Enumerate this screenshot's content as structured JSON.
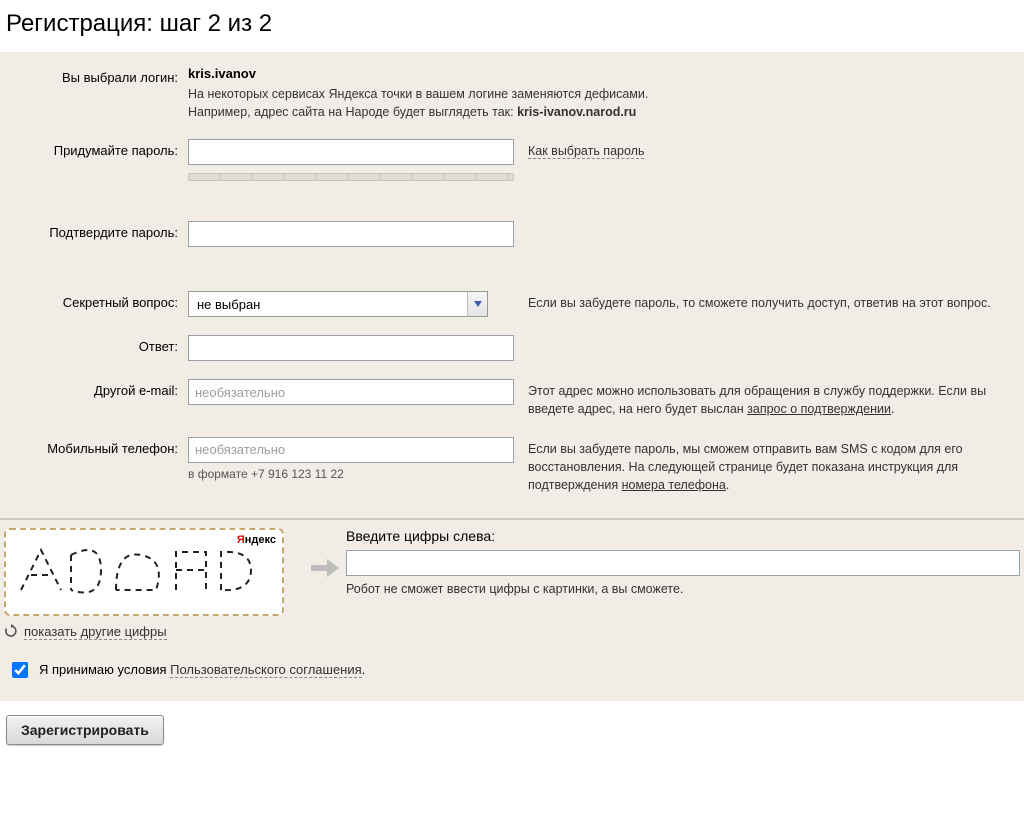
{
  "page_title": "Регистрация: шаг 2 из 2",
  "login": {
    "label": "Вы выбрали логин:",
    "value": "kris.ivanov",
    "note_line1": "На некоторых сервисах Яндекса точки в вашем логине заменяются дефисами.",
    "note_line2_prefix": "Например, адрес сайта на Народе будет выглядеть так: ",
    "note_line2_bold": "kris-ivanov.narod.ru"
  },
  "password": {
    "label": "Придумайте пароль:",
    "help_link": "Как выбрать пароль"
  },
  "password_confirm": {
    "label": "Подтвердите пароль:"
  },
  "secret_question": {
    "label": "Секретный вопрос:",
    "selected": "не выбран",
    "help": "Если вы забудете пароль, то сможете получить доступ, ответив на этот вопрос."
  },
  "answer": {
    "label": "Ответ:"
  },
  "other_email": {
    "label": "Другой e-mail:",
    "placeholder": "необязательно",
    "help_text_before": "Этот адрес можно использовать для обращения в службу поддержки. Если вы введете адрес, на него будет выслан ",
    "help_link": "запрос о подтверждении",
    "help_text_after": "."
  },
  "mobile": {
    "label": "Мобильный телефон:",
    "placeholder": "необязательно",
    "format_hint": "в формате +7 916 123 11 22",
    "help_text_before": "Если вы забудете пароль, мы сможем отправить вам SMS с кодом для его восстановления. На следующей странице будет показана инструкция для подтверждения ",
    "help_link": "номера телефона",
    "help_text_after": "."
  },
  "captcha": {
    "brand_y": "Я",
    "brand_rest": "ндекс",
    "instruction": "Введите цифры слева:",
    "hint": "Робот не сможет ввести цифры с картинки, а вы сможете.",
    "refresh_label": "показать другие цифры"
  },
  "agreement": {
    "text_prefix": "Я принимаю условия ",
    "link_text": "Пользовательского соглашения",
    "text_suffix": ".",
    "checked": true
  },
  "submit_label": "Зарегистрировать"
}
